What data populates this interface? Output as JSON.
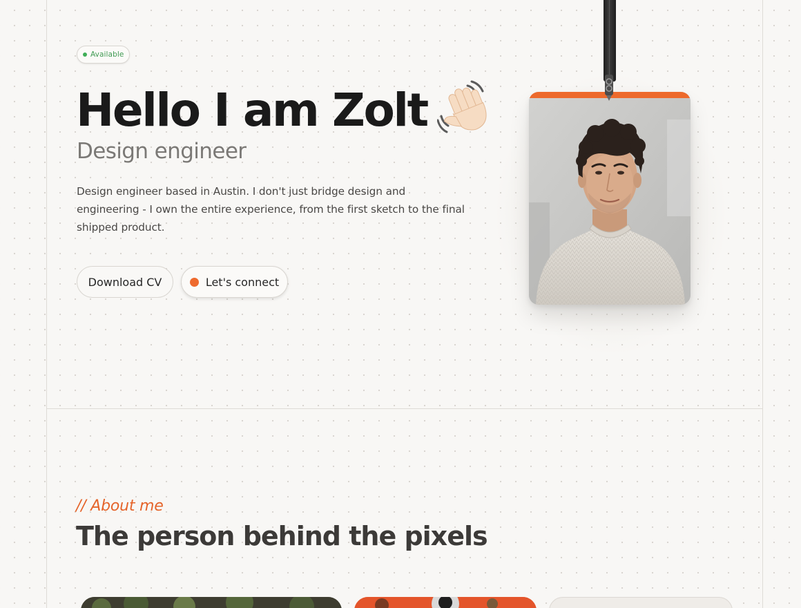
{
  "status": {
    "label": "Available",
    "color": "#3fae57"
  },
  "hero": {
    "title": "Hello I am Zolt",
    "wave_icon": "waving-hand-icon",
    "subtitle": "Design engineer",
    "bio": "Design engineer based in Austin. I don't just bridge design and engineering - I own the entire experience, from the first sketch to the final shipped product."
  },
  "actions": {
    "download_cv": "Download CV",
    "connect": "Let's connect",
    "accent": "#ee6a2e"
  },
  "badge": {
    "strip_color": "#ed6a2c",
    "portrait": "portrait-photo"
  },
  "about": {
    "kicker": "// About me",
    "title": "The person behind the pixels"
  }
}
